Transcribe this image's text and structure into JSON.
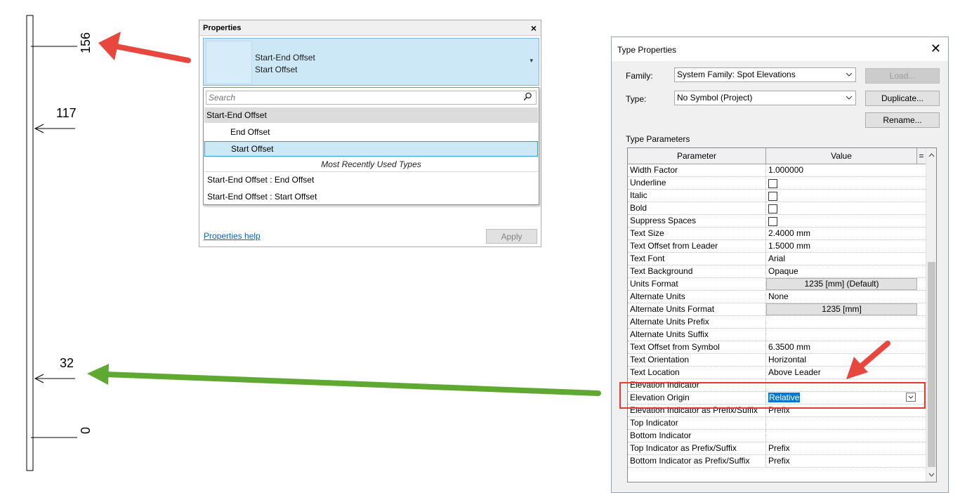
{
  "drawing": {
    "elevations": [
      "156",
      "117",
      "32",
      "0"
    ]
  },
  "properties_panel": {
    "title": "Properties",
    "close_glyph": "×",
    "type_selector": {
      "family": "Start-End Offset",
      "type": "Start Offset",
      "arrow_glyph": "▾"
    },
    "dropdown": {
      "search_placeholder": "Search",
      "search_icon": "magnifier-icon",
      "group_label": "Start-End Offset",
      "children": [
        "End Offset",
        "Start Offset"
      ],
      "selected": "Start Offset",
      "mru_header": "Most Recently Used Types",
      "mru_items": [
        "Start-End Offset : End Offset",
        "Start-End Offset : Start Offset"
      ]
    },
    "help_link": "Properties help",
    "apply_label": "Apply"
  },
  "type_properties": {
    "title": "Type Properties",
    "close_glyph": "✕",
    "family_label": "Family:",
    "family_value": "System Family: Spot Elevations",
    "type_label": "Type:",
    "type_value": "No Symbol (Project)",
    "buttons": {
      "load": "Load...",
      "duplicate": "Duplicate...",
      "rename": "Rename..."
    },
    "section_label": "Type Parameters",
    "columns": {
      "parameter": "Parameter",
      "value": "Value",
      "eq": "="
    },
    "rows": [
      {
        "param": "Width Factor",
        "value": "1.000000"
      },
      {
        "param": "Underline",
        "value": "",
        "checkbox": true
      },
      {
        "param": "Italic",
        "value": "",
        "checkbox": true
      },
      {
        "param": "Bold",
        "value": "",
        "checkbox": true
      },
      {
        "param": "Suppress Spaces",
        "value": "",
        "checkbox": true
      },
      {
        "param": "Text Size",
        "value": "2.4000 mm"
      },
      {
        "param": "Text Offset from Leader",
        "value": "1.5000 mm"
      },
      {
        "param": "Text Font",
        "value": "Arial"
      },
      {
        "param": "Text Background",
        "value": "Opaque"
      },
      {
        "param": "Units Format",
        "value": "1235 [mm] (Default)",
        "button": true
      },
      {
        "param": "Alternate Units",
        "value": "None"
      },
      {
        "param": "Alternate Units Format",
        "value": "1235 [mm]",
        "button": true
      },
      {
        "param": "Alternate Units Prefix",
        "value": ""
      },
      {
        "param": "Alternate Units Suffix",
        "value": ""
      },
      {
        "param": "Text Offset from Symbol",
        "value": "6.3500 mm"
      },
      {
        "param": "Text Orientation",
        "value": "Horizontal"
      },
      {
        "param": "Text Location",
        "value": "Above Leader"
      },
      {
        "param": "Elevation Indicator",
        "value": ""
      },
      {
        "param": "Elevation Origin",
        "value": "Relative",
        "selected": true
      },
      {
        "param": "Elevation Indicator as Prefix/Suffix",
        "value": "Prefix"
      },
      {
        "param": "Top Indicator",
        "value": ""
      },
      {
        "param": "Bottom Indicator",
        "value": ""
      },
      {
        "param": "Top Indicator as Prefix/Suffix",
        "value": "Prefix"
      },
      {
        "param": "Bottom Indicator as Prefix/Suffix",
        "value": "Prefix"
      }
    ]
  },
  "annotations": {
    "red_color": "#e8473d",
    "green_color": "#5fa832",
    "highlight_color": "#e03c31"
  }
}
